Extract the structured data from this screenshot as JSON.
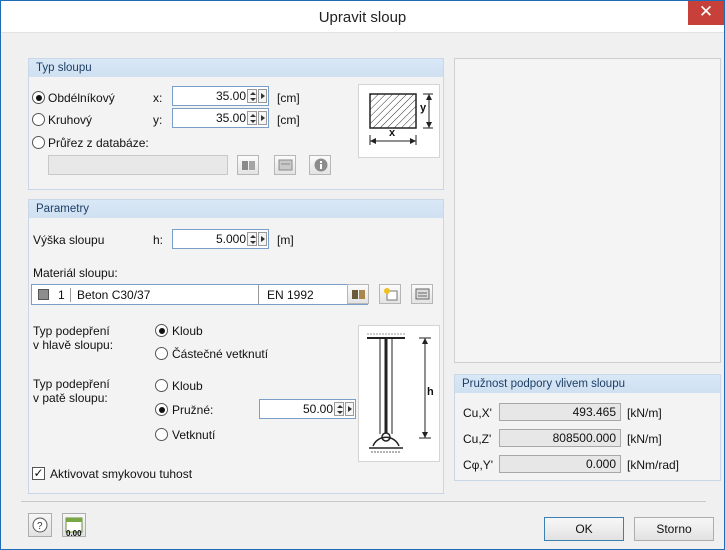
{
  "window": {
    "title": "Upravit sloup",
    "close_glyph": "✕"
  },
  "column_type": {
    "header": "Typ sloupu",
    "rect_label": "Obdélníkový",
    "round_label": "Kruhový",
    "db_label": "Průřez z databáze:",
    "x_label": "x:",
    "y_label": "y:",
    "x_value": "35.00",
    "y_value": "35.00",
    "unit": "[cm]",
    "diagram_x": "x",
    "diagram_y": "y",
    "selected": "rect"
  },
  "params": {
    "header": "Parametry",
    "height_label": "Výška sloupu",
    "h_label": "h:",
    "h_value": "5.000",
    "h_unit": "[m]",
    "material_label": "Materiál sloupu:",
    "material_number": "1",
    "material_name": "Beton C30/37",
    "material_norm": "EN 1992",
    "head_support_label_1": "Typ podepření",
    "head_support_label_2": "v hlavě sloupu:",
    "head_opt_hinge": "Kloub",
    "head_opt_partial": "Částečné vetknutí",
    "foot_support_label_1": "Typ podepření",
    "foot_support_label_2": "v patě sloupu:",
    "foot_opt_hinge": "Kloub",
    "foot_opt_elastic": "Pružné:",
    "foot_opt_fixed": "Vetknutí",
    "elastic_value": "50.00",
    "elastic_unit": "[%]",
    "diagram_h": "h",
    "shear_checkbox_label": "Aktivovat smykovou tuhost",
    "shear_checked": true
  },
  "support": {
    "header": "Pružnost podpory vlivem sloupu",
    "rows": [
      {
        "label": "Cu,X'",
        "value": "493.465",
        "unit": "[kN/m]"
      },
      {
        "label": "Cu,Z'",
        "value": "808500.000",
        "unit": "[kN/m]"
      },
      {
        "label": "Cφ,Y'",
        "value": "0.000",
        "unit": "[kNm/rad]"
      }
    ]
  },
  "footer": {
    "ok_label": "OK",
    "cancel_label": "Storno",
    "units_icon_text": "0.00"
  },
  "colors": {
    "accent": "#1f6bb5",
    "close": "#c7403a",
    "header_text": "#1e3f66"
  }
}
